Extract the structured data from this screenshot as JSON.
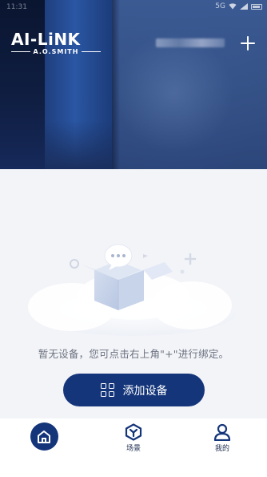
{
  "status_bar": {
    "time": "11:31",
    "extra": "5G"
  },
  "header": {
    "logo_main": "AI-LiNK",
    "logo_sub": "A.O.SMITH",
    "user_name_redacted": true,
    "add_icon": "plus-icon"
  },
  "empty_state": {
    "illustration": "empty-box-cloud-illustration",
    "message": "暂无设备，您可点击右上角\"+\"进行绑定。",
    "add_device_label": "添加设备",
    "add_device_icon": "grid-icon"
  },
  "tabbar": {
    "items": [
      {
        "label": "",
        "icon": "home-icon",
        "active": true
      },
      {
        "label": "场景",
        "icon": "scene-hexagon-icon",
        "active": false
      },
      {
        "label": "我的",
        "icon": "user-icon",
        "active": false
      }
    ]
  },
  "colors": {
    "primary": "#14357a",
    "background": "#f3f4f8",
    "text_muted": "#6c7280"
  }
}
